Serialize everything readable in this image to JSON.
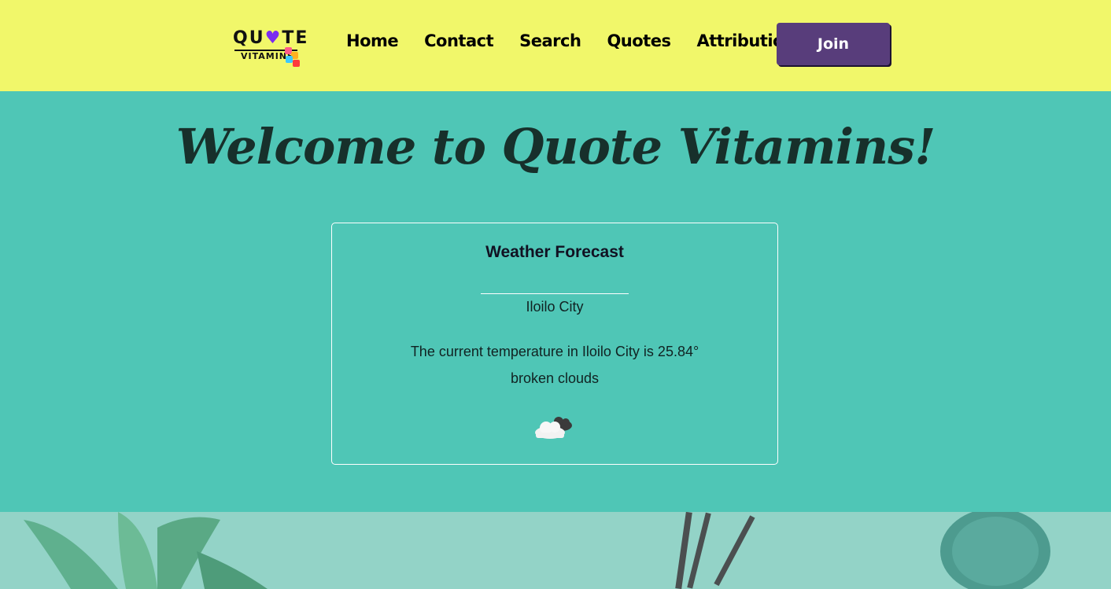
{
  "logo": {
    "line1_a": "QU",
    "line1_b": "TE",
    "line2": "VITAMINS"
  },
  "nav": [
    "Home",
    "Contact",
    "Search",
    "Quotes",
    "Attributions"
  ],
  "join_label": "Join",
  "hero": {
    "title": "Welcome to Quote Vitamins!"
  },
  "weather": {
    "heading": "Weather Forecast",
    "city": "Iloilo City",
    "temperature_text": "The current temperature in Iloilo City is 25.84°",
    "description": "broken clouds"
  },
  "colors": {
    "topbar": "#f1f76a",
    "hero_bg": "#4fc6b6",
    "join_bg": "#583d7b",
    "heart": "#7b2cf0"
  }
}
